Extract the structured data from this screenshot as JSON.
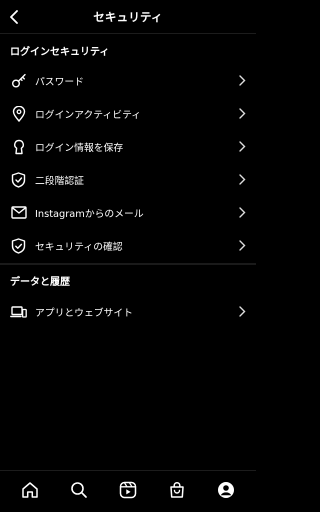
{
  "header": {
    "title": "セキュリティ"
  },
  "login_security": {
    "title": "ログインセキュリティ",
    "items": [
      {
        "label": "パスワード",
        "icon": "key-icon"
      },
      {
        "label": "ログインアクティビティ",
        "icon": "location-pin-icon"
      },
      {
        "label": "ログイン情報を保存",
        "icon": "keyhole-icon"
      },
      {
        "label": "二段階認証",
        "icon": "shield-check-icon"
      },
      {
        "label": "Instagramからのメール",
        "icon": "mail-icon"
      },
      {
        "label": "セキュリティの確認",
        "icon": "shield-tick-icon"
      }
    ]
  },
  "data_history": {
    "title": "データと履歴",
    "items": [
      {
        "label": "アプリとウェブサイト",
        "icon": "devices-icon"
      }
    ]
  },
  "bottom_nav": [
    "home-icon",
    "search-icon",
    "reels-icon",
    "shop-icon",
    "profile-icon"
  ]
}
